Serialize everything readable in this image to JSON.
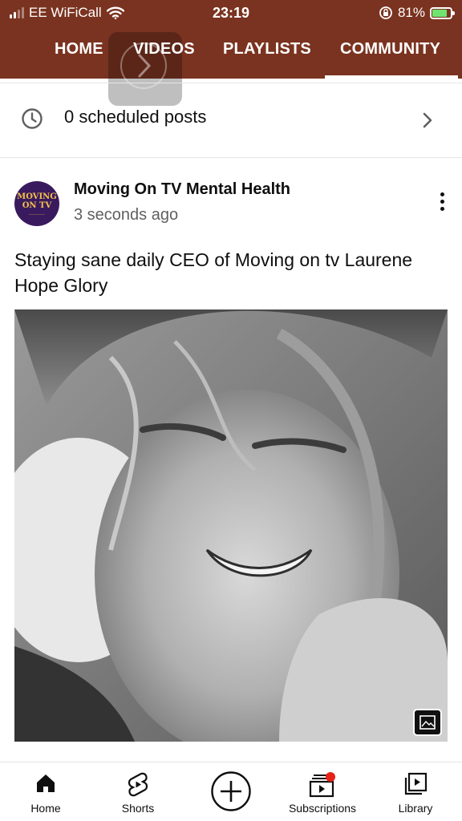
{
  "status_bar": {
    "carrier": "EE WiFiCall",
    "time": "23:19",
    "battery_percent": "81%",
    "battery_level": 0.81,
    "icons": [
      "signal-icon",
      "wifi-icon",
      "rotation-lock-icon",
      "battery-charging-icon"
    ]
  },
  "tabs": [
    {
      "label": "HOME"
    },
    {
      "label": "VIDEOS"
    },
    {
      "label": "PLAYLISTS"
    },
    {
      "label": "COMMUNITY",
      "active": true
    }
  ],
  "scheduled": {
    "label": "0 scheduled posts",
    "icon": "clock-icon"
  },
  "post": {
    "channel": "Moving On TV Mental Health",
    "time_ago": "3 seconds ago",
    "text": "Staying sane daily CEO of Moving on tv Laurene Hope Glory",
    "avatar_text": "MOVING ON TV",
    "image_badge_icon": "image-icon"
  },
  "bottom_nav": [
    {
      "label": "Home",
      "icon": "home-icon"
    },
    {
      "label": "Shorts",
      "icon": "shorts-icon"
    },
    {
      "label": "",
      "icon": "create-plus-icon"
    },
    {
      "label": "Subscriptions",
      "icon": "subscriptions-icon"
    },
    {
      "label": "Library",
      "icon": "library-icon"
    }
  ],
  "colors": {
    "header_bg": "#7a3320",
    "notification_dot": "#e62117",
    "battery_fill": "#6fe36f"
  }
}
